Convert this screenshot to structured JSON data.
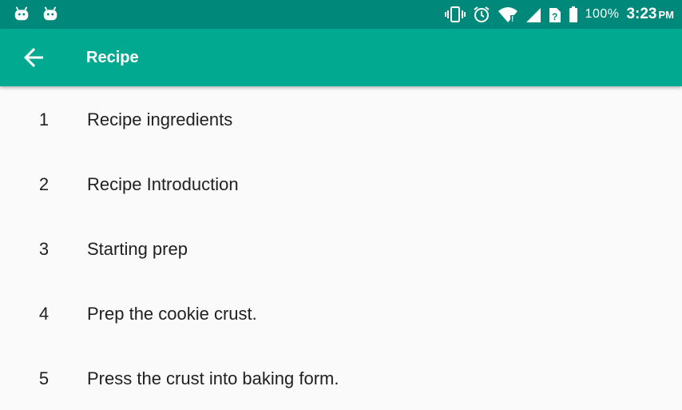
{
  "status_bar": {
    "notification_icons": [
      "android-icon",
      "android-icon"
    ],
    "system_icons": [
      "vibrate-icon",
      "alarm-icon",
      "wifi-icon",
      "signal-icon",
      "no-sim-icon",
      "battery-icon"
    ],
    "battery_percent": "100%",
    "time": "3:23",
    "ampm": "PM"
  },
  "app_bar": {
    "back_icon": "arrow-back-icon",
    "title": "Recipe",
    "color": "#00a98f",
    "status_color": "#00897b"
  },
  "steps": [
    {
      "number": "1",
      "label": "Recipe ingredients"
    },
    {
      "number": "2",
      "label": "Recipe Introduction"
    },
    {
      "number": "3",
      "label": "Starting prep"
    },
    {
      "number": "4",
      "label": "Prep the cookie crust."
    },
    {
      "number": "5",
      "label": "Press the crust into baking form."
    }
  ]
}
